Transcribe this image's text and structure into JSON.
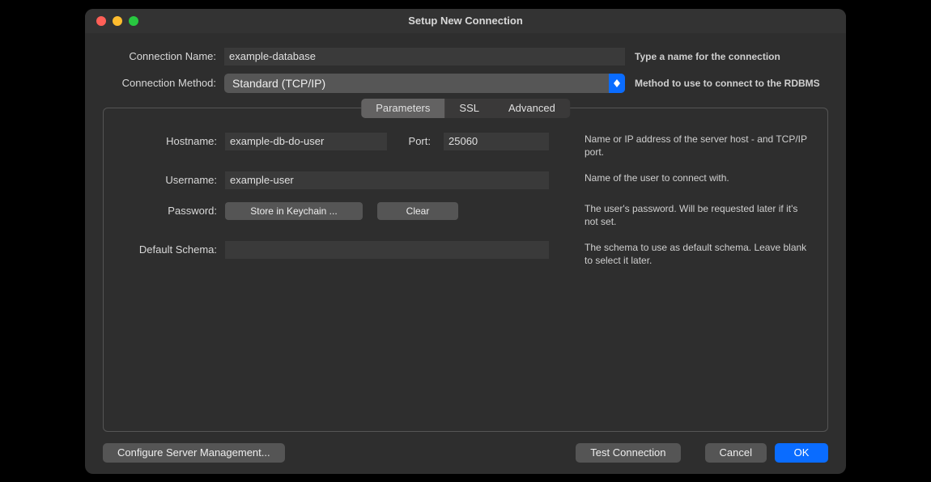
{
  "window": {
    "title": "Setup New Connection"
  },
  "top": {
    "name_label": "Connection Name:",
    "name_value": "example-database",
    "name_hint": "Type a name for the connection",
    "method_label": "Connection Method:",
    "method_value": "Standard (TCP/IP)",
    "method_hint": "Method to use to connect to the RDBMS"
  },
  "tabs": {
    "parameters": "Parameters",
    "ssl": "SSL",
    "advanced": "Advanced"
  },
  "form": {
    "hostname_label": "Hostname:",
    "hostname_value": "example-db-do-user",
    "port_label": "Port:",
    "port_value": "25060",
    "hostname_hint": "Name or IP address of the server host - and TCP/IP port.",
    "username_label": "Username:",
    "username_value": "example-user",
    "username_hint": "Name of the user to connect with.",
    "password_label": "Password:",
    "store_btn": "Store in Keychain ...",
    "clear_btn": "Clear",
    "password_hint": "The user's password. Will be requested later if it's not set.",
    "schema_label": "Default Schema:",
    "schema_value": "",
    "schema_hint": "The schema to use as default schema. Leave blank to select it later."
  },
  "footer": {
    "configure": "Configure Server Management...",
    "test": "Test Connection",
    "cancel": "Cancel",
    "ok": "OK"
  }
}
